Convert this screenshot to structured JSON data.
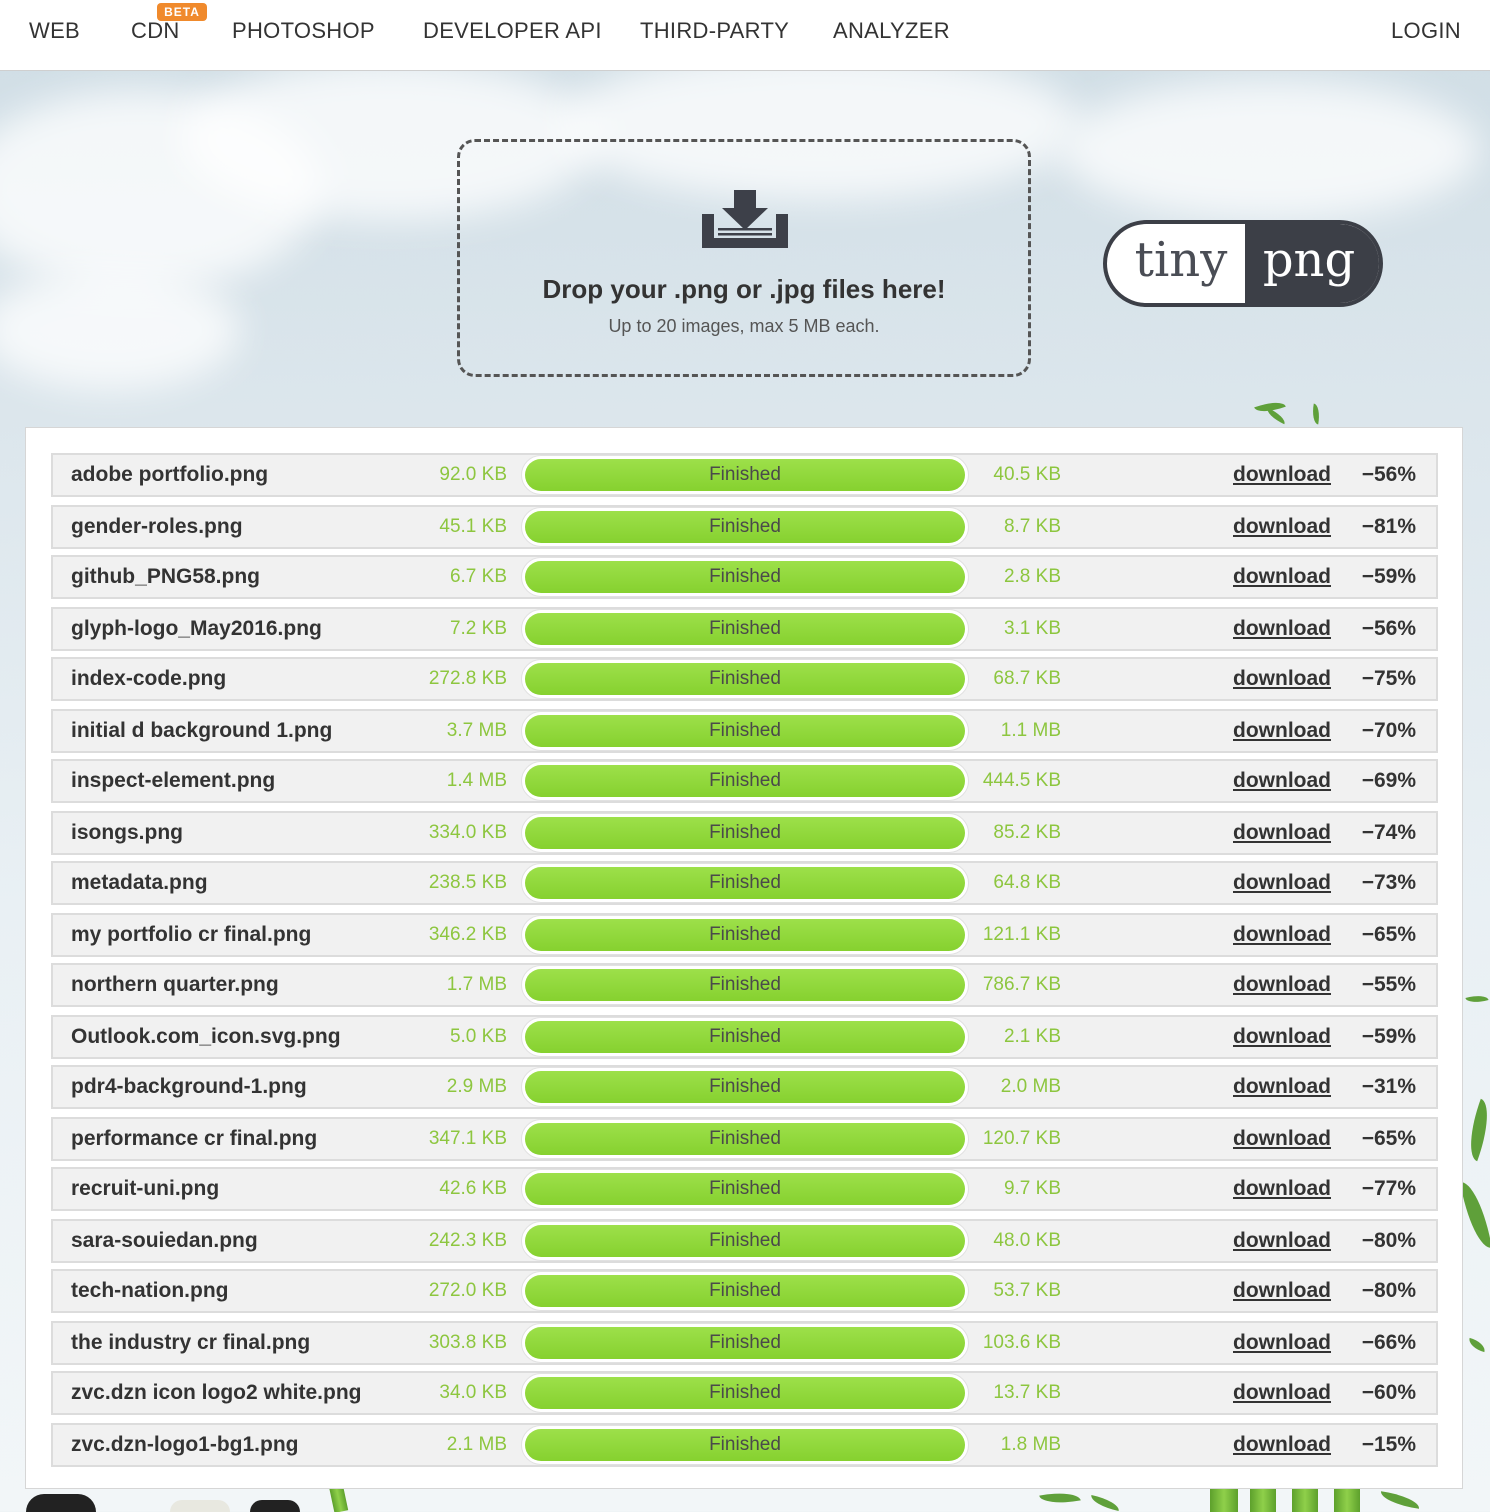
{
  "nav": {
    "items": [
      "WEB",
      "CDN",
      "PHOTOSHOP",
      "DEVELOPER API",
      "THIRD-PARTY",
      "ANALYZER"
    ],
    "badge": "BETA",
    "login": "LOGIN"
  },
  "dropzone": {
    "icon": "download-tray-icon",
    "title": "Drop your .png or .jpg files here!",
    "subtitle": "Up to 20 images, max 5 MB each."
  },
  "logo": {
    "left": "tiny",
    "right": "png"
  },
  "results": {
    "status_label": "Finished",
    "download_label": "download",
    "progress_fraction": 1.0,
    "colors": {
      "bar": "#8fd43a",
      "size_text": "#8dc63f"
    },
    "rows": [
      {
        "name": "adobe portfolio.png",
        "original": "92.0 KB",
        "compressed": "40.5 KB",
        "saving": "−56%"
      },
      {
        "name": "gender-roles.png",
        "original": "45.1 KB",
        "compressed": "8.7 KB",
        "saving": "−81%"
      },
      {
        "name": "github_PNG58.png",
        "original": "6.7 KB",
        "compressed": "2.8 KB",
        "saving": "−59%"
      },
      {
        "name": "glyph-logo_May2016.png",
        "original": "7.2 KB",
        "compressed": "3.1 KB",
        "saving": "−56%"
      },
      {
        "name": "index-code.png",
        "original": "272.8 KB",
        "compressed": "68.7 KB",
        "saving": "−75%"
      },
      {
        "name": "initial d background 1.png",
        "original": "3.7 MB",
        "compressed": "1.1 MB",
        "saving": "−70%"
      },
      {
        "name": "inspect-element.png",
        "original": "1.4 MB",
        "compressed": "444.5 KB",
        "saving": "−69%"
      },
      {
        "name": "isongs.png",
        "original": "334.0 KB",
        "compressed": "85.2 KB",
        "saving": "−74%"
      },
      {
        "name": "metadata.png",
        "original": "238.5 KB",
        "compressed": "64.8 KB",
        "saving": "−73%"
      },
      {
        "name": "my portfolio cr final.png",
        "original": "346.2 KB",
        "compressed": "121.1 KB",
        "saving": "−65%"
      },
      {
        "name": "northern quarter.png",
        "original": "1.7 MB",
        "compressed": "786.7 KB",
        "saving": "−55%"
      },
      {
        "name": "Outlook.com_icon.svg.png",
        "original": "5.0 KB",
        "compressed": "2.1 KB",
        "saving": "−59%"
      },
      {
        "name": "pdr4-background-1.png",
        "original": "2.9 MB",
        "compressed": "2.0 MB",
        "saving": "−31%"
      },
      {
        "name": "performance cr final.png",
        "original": "347.1 KB",
        "compressed": "120.7 KB",
        "saving": "−65%"
      },
      {
        "name": "recruit-uni.png",
        "original": "42.6 KB",
        "compressed": "9.7 KB",
        "saving": "−77%"
      },
      {
        "name": "sara-souiedan.png",
        "original": "242.3 KB",
        "compressed": "48.0 KB",
        "saving": "−80%"
      },
      {
        "name": "tech-nation.png",
        "original": "272.0 KB",
        "compressed": "53.7 KB",
        "saving": "−80%"
      },
      {
        "name": "the industry cr final.png",
        "original": "303.8 KB",
        "compressed": "103.6 KB",
        "saving": "−66%"
      },
      {
        "name": "zvc.dzn icon logo2 white.png",
        "original": "34.0 KB",
        "compressed": "13.7 KB",
        "saving": "−60%"
      },
      {
        "name": "zvc.dzn-logo1-bg1.png",
        "original": "2.1 MB",
        "compressed": "1.8 MB",
        "saving": "−15%"
      }
    ]
  }
}
